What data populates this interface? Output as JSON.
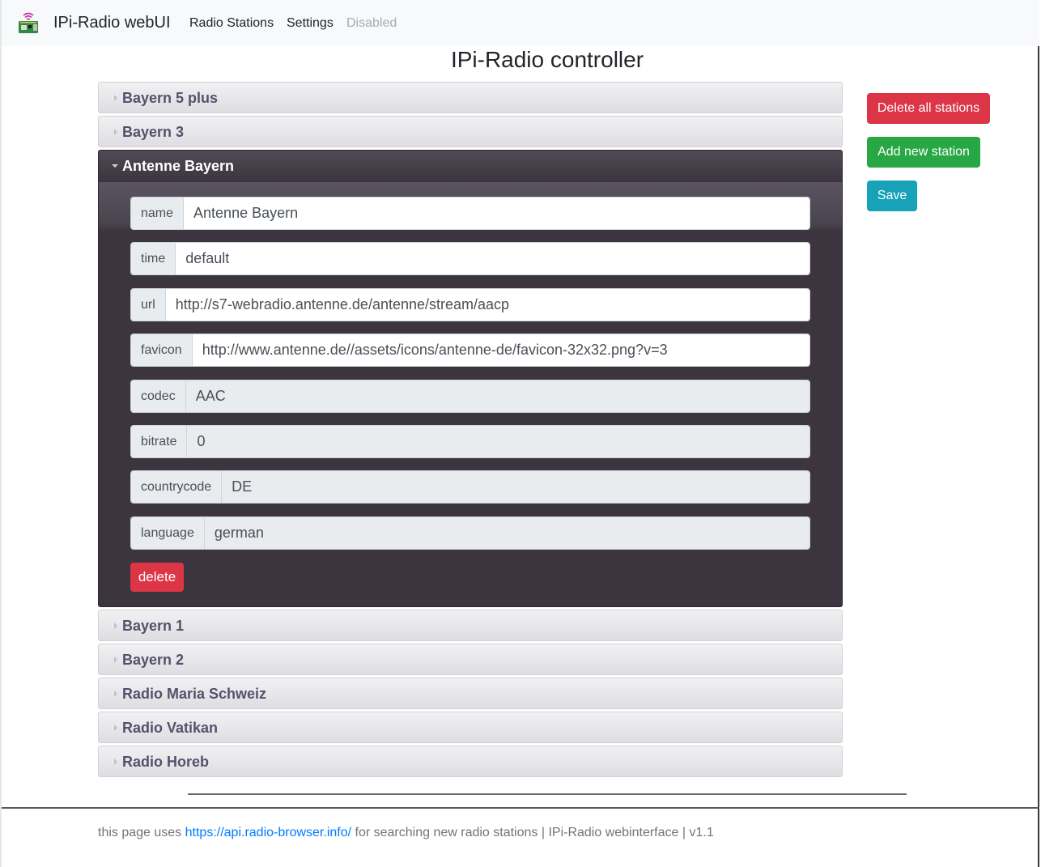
{
  "navbar": {
    "brand": "IPi-Radio webUI",
    "logo_icon": "raspberry-pi-radio-icon",
    "links": [
      {
        "label": "Radio Stations",
        "disabled": false
      },
      {
        "label": "Settings",
        "disabled": false
      },
      {
        "label": "Disabled",
        "disabled": true
      }
    ]
  },
  "page_title": "IPi-Radio controller",
  "stations_before": [
    "Bayern 5 plus",
    "Bayern 3"
  ],
  "open_station": {
    "title": "Antenne Bayern",
    "fields": [
      {
        "key": "name",
        "value": "Antenne Bayern",
        "readonly": false
      },
      {
        "key": "time",
        "value": "default",
        "readonly": false
      },
      {
        "key": "url",
        "value": "http://s7-webradio.antenne.de/antenne/stream/aacp",
        "readonly": false
      },
      {
        "key": "favicon",
        "value": "http://www.antenne.de//assets/icons/antenne-de/favicon-32x32.png?v=3",
        "readonly": false
      },
      {
        "key": "codec",
        "value": "AAC",
        "readonly": true
      },
      {
        "key": "bitrate",
        "value": "0",
        "readonly": true
      },
      {
        "key": "countrycode",
        "value": "DE",
        "readonly": true
      },
      {
        "key": "language",
        "value": "german",
        "readonly": true
      }
    ],
    "delete_label": "delete"
  },
  "stations_after": [
    "Bayern 1",
    "Bayern 2",
    "Radio Maria Schweiz",
    "Radio Vatikan",
    "Radio Horeb"
  ],
  "actions": {
    "delete_all": "Delete all stations",
    "add_new": "Add new station",
    "save": "Save"
  },
  "footer": {
    "prefix": "this page uses ",
    "link": "https://api.radio-browser.info/",
    "suffix": " for searching new radio stations | IPi-Radio webinterface | v1.1"
  },
  "colors": {
    "danger": "#dc3545",
    "success": "#28a745",
    "info": "#17a2b8",
    "link": "#007bff",
    "accordion_active": "#3c3540"
  }
}
